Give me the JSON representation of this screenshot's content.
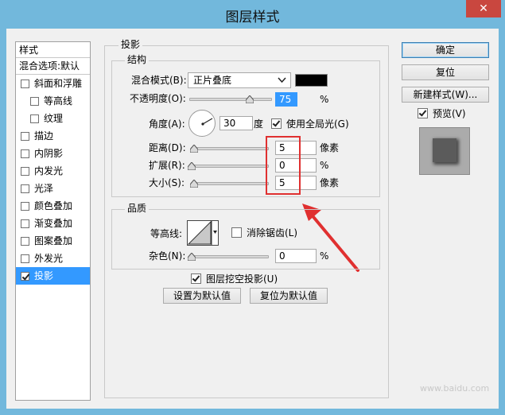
{
  "window": {
    "title": "图层样式",
    "close": "✕"
  },
  "list": {
    "header": "样式",
    "blend": "混合选项:默认",
    "items": [
      {
        "label": "斜面和浮雕",
        "checked": false,
        "sub": false
      },
      {
        "label": "等高线",
        "checked": false,
        "sub": true
      },
      {
        "label": "纹理",
        "checked": false,
        "sub": true
      },
      {
        "label": "描边",
        "checked": false,
        "sub": false
      },
      {
        "label": "内阴影",
        "checked": false,
        "sub": false
      },
      {
        "label": "内发光",
        "checked": false,
        "sub": false
      },
      {
        "label": "光泽",
        "checked": false,
        "sub": false
      },
      {
        "label": "颜色叠加",
        "checked": false,
        "sub": false
      },
      {
        "label": "渐变叠加",
        "checked": false,
        "sub": false
      },
      {
        "label": "图案叠加",
        "checked": false,
        "sub": false
      },
      {
        "label": "外发光",
        "checked": false,
        "sub": false
      },
      {
        "label": "投影",
        "checked": true,
        "sub": false,
        "selected": true
      }
    ]
  },
  "shadow": {
    "group_title": "投影",
    "structure_title": "结构",
    "blend_mode_label": "混合模式(B):",
    "blend_mode_value": "正片叠底",
    "shadow_color": "#000000",
    "opacity_label": "不透明度(O):",
    "opacity_value": "75",
    "opacity_unit": "%",
    "angle_label": "角度(A):",
    "angle_value": "30",
    "angle_unit": "度",
    "global_light_label": "使用全局光(G)",
    "distance_label": "距离(D):",
    "distance_value": "5",
    "distance_unit": "像素",
    "spread_label": "扩展(R):",
    "spread_value": "0",
    "spread_unit": "%",
    "size_label": "大小(S):",
    "size_value": "5",
    "size_unit": "像素",
    "quality_title": "品质",
    "contour_label": "等高线:",
    "antialias_label": "消除锯齿(L)",
    "noise_label": "杂色(N):",
    "noise_value": "0",
    "noise_unit": "%",
    "knockout_label": "图层挖空投影(U)",
    "set_default": "设置为默认值",
    "reset_default": "复位为默认值"
  },
  "buttons": {
    "ok": "确定",
    "reset": "复位",
    "new_style": "新建样式(W)...",
    "preview": "预览(V)"
  },
  "colors": {
    "accent": "#3399ff",
    "highlight_box": "#e03030"
  },
  "watermark": "www.baidu.com"
}
